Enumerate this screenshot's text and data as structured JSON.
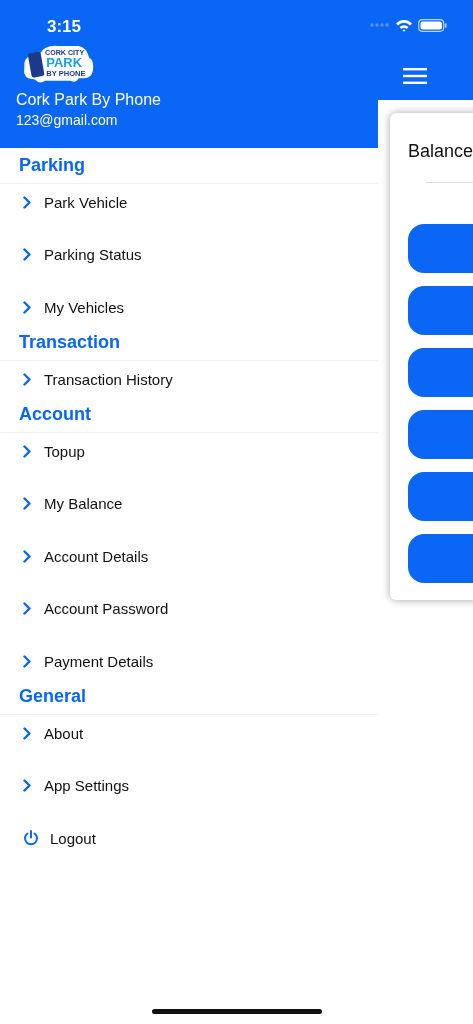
{
  "status_bar": {
    "time": "3:15"
  },
  "drawer": {
    "logo": {
      "top": "CORK CITY",
      "middle": "PARK",
      "bottom": "BY PHONE"
    },
    "app_name": "Cork Park By Phone",
    "email": "123@gmail.com",
    "sections": [
      {
        "heading": "Parking",
        "items": [
          "Park Vehicle",
          "Parking Status",
          "My Vehicles"
        ]
      },
      {
        "heading": "Transaction",
        "items": [
          "Transaction History"
        ]
      },
      {
        "heading": "Account",
        "items": [
          "Topup",
          "My Balance",
          "Account Details",
          "Account Password",
          "Payment Details"
        ]
      },
      {
        "heading": "General",
        "items": [
          "About",
          "App Settings"
        ]
      }
    ],
    "logout": "Logout"
  },
  "main": {
    "card_title": "Balance"
  }
}
